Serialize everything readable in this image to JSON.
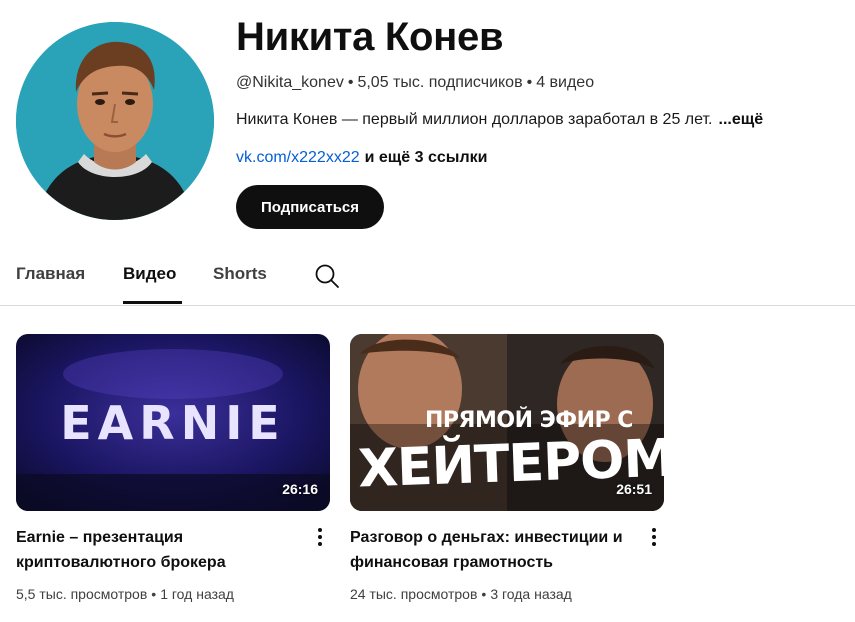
{
  "channel": {
    "name": "Никита Конев",
    "handle": "@Nikita_konev",
    "subscribers": "5,05 тыс. подписчиков",
    "video_count": "4 видео",
    "separator": "•",
    "description": "Никита Конев — первый миллион долларов заработал в 25 лет.",
    "description_more": "...ещё",
    "link": "vk.com/x222xx22",
    "more_links": "и ещё 3 ссылки",
    "subscribe_label": "Подписаться"
  },
  "tabs": [
    {
      "label": "Главная",
      "active": false
    },
    {
      "label": "Видео",
      "active": true
    },
    {
      "label": "Shorts",
      "active": false
    }
  ],
  "search_icon": "search-icon",
  "videos": [
    {
      "thumbnail_text": "EARNIE",
      "duration": "26:16",
      "title": "Earnie – презентация криптовалютного брокера",
      "views": "5,5 тыс. просмотров",
      "age": "1 год назад"
    },
    {
      "thumbnail_text_top": "ПРЯМОЙ ЭФИР С",
      "thumbnail_text_main": "ХЕЙТЕРОМ",
      "duration": "26:51",
      "title": "Разговор о деньгах: инвестиции и финансовая грамотность",
      "views": "24 тыс. просмотров",
      "age": "3 года назад"
    }
  ],
  "colors": {
    "avatar_bg": "#2aa3b8",
    "subscribe_bg": "#0f0f0f",
    "link": "#065fd4"
  }
}
